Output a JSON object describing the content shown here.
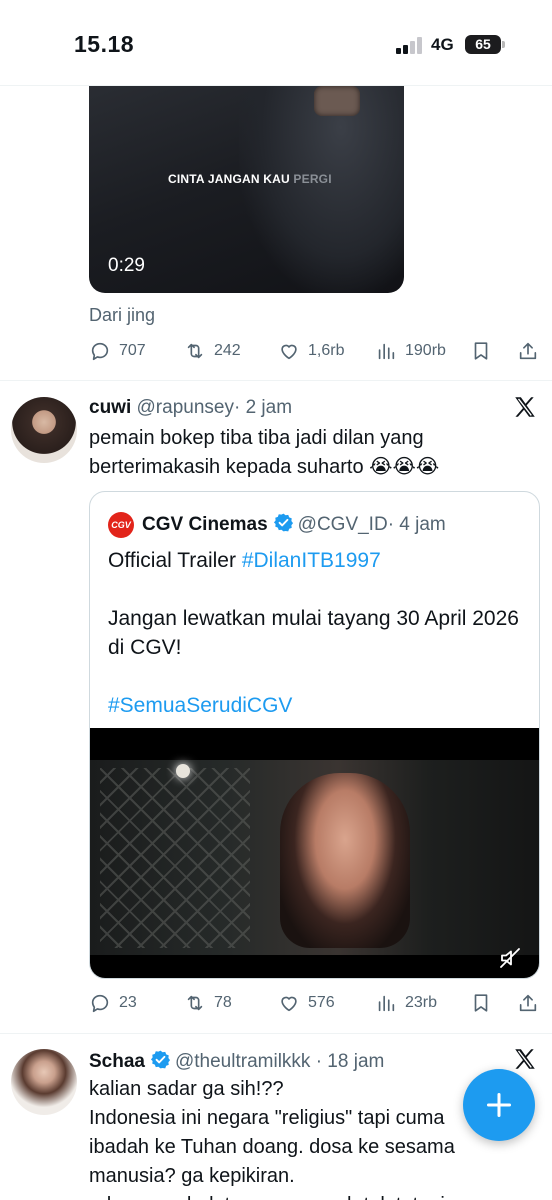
{
  "status_bar": {
    "time": "15.18",
    "network": "4G",
    "battery": "65"
  },
  "tweet1": {
    "video_caption_bright": "CINTA JANGAN KAU ",
    "video_caption_faded": "PERGI",
    "video_duration": "0:29",
    "from_text": "Dari jing",
    "stats": {
      "replies": "707",
      "retweets": "242",
      "likes": "1,6rb",
      "views": "190rb"
    }
  },
  "tweet2": {
    "name": "cuwi",
    "handle": "@rapunsey",
    "time": "· 2 jam",
    "text_line1": "pemain bokep tiba tiba jadi dilan yang",
    "text_line2": "berterimakasih kepada suharto 😭😭😭",
    "quote": {
      "logo_text": "CGV",
      "name": "CGV Cinemas",
      "handle": "@CGV_ID",
      "time": "· 4 jam",
      "line1_prefix": "Official Trailer ",
      "line1_tag": "#DilanITB1997",
      "paragraph2": "Jangan lewatkan mulai tayang 30 April 2026 di CGV!",
      "tag2": "#SemuaSerudiCGV"
    },
    "stats": {
      "replies": "23",
      "retweets": "78",
      "likes": "576",
      "views": "23rb"
    }
  },
  "tweet3": {
    "name": "Schaa",
    "handle": "@theultramilkkk",
    "time": "· 18 jam",
    "text_line1": "kalian sadar ga sih!??",
    "text_line2": "Indonesia ini negara \"religius\" tapi cuma",
    "text_line3": "ibadah ke Tuhan doang. dosa ke sesama",
    "text_line4": "manusia? ga kepikiran.",
    "text_line5": "ada yang sholatnya ga pernah telat, tapi"
  },
  "colors": {
    "accent": "#1d9bf0",
    "secondary_text": "#536471",
    "text": "#0f1419",
    "cgv_red": "#e2241a"
  },
  "icons": [
    "reply-icon",
    "retweet-icon",
    "like-icon",
    "views-icon",
    "bookmark-icon",
    "share-icon",
    "x-logo-icon",
    "verified-icon",
    "mute-icon",
    "compose-plus-icon"
  ]
}
